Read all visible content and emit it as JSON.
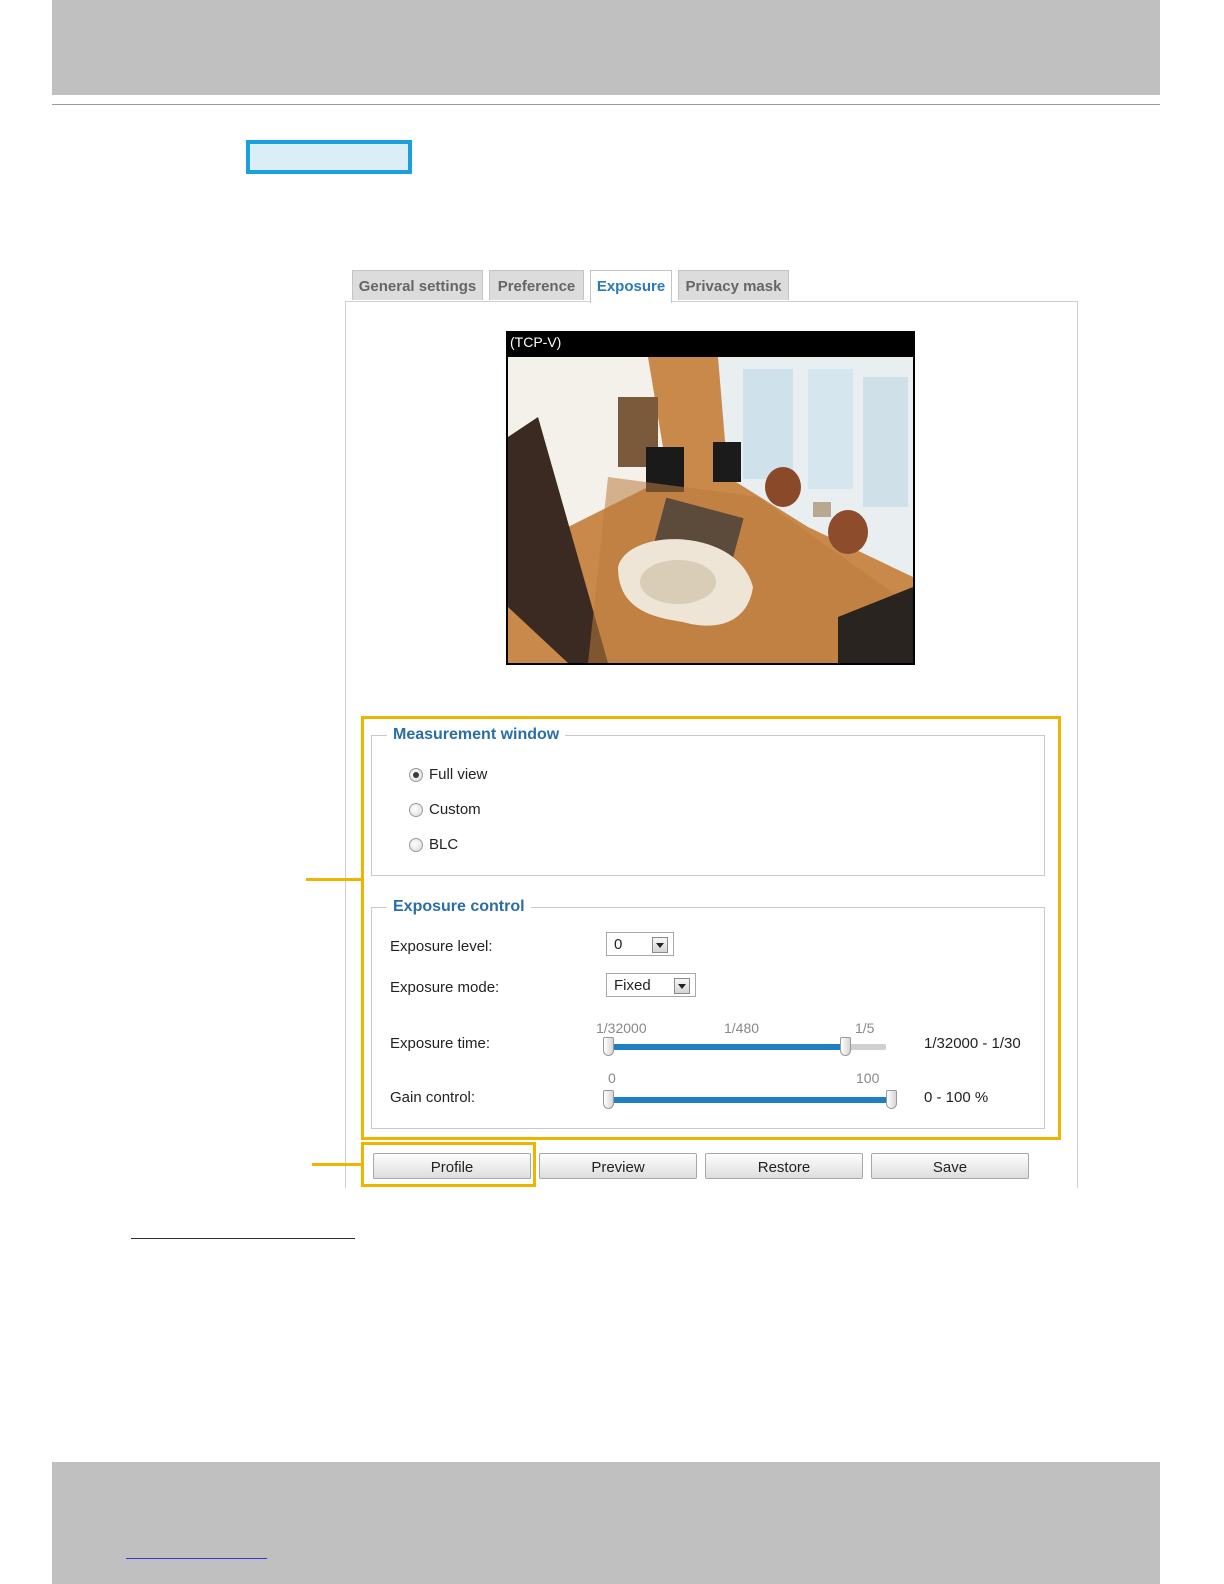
{
  "tabs": [
    "General settings",
    "Preference",
    "Exposure",
    "Privacy mask"
  ],
  "video": {
    "title": "(TCP-V)"
  },
  "measurement_window": {
    "legend": "Measurement window",
    "options": [
      "Full view",
      "Custom",
      "BLC"
    ],
    "selected": "Full view"
  },
  "exposure_control": {
    "legend": "Exposure control",
    "level_label": "Exposure level:",
    "level_value": "0",
    "mode_label": "Exposure mode:",
    "mode_value": "Fixed",
    "time_label": "Exposure time:",
    "time_ticks": [
      "1/32000",
      "1/480",
      "1/5"
    ],
    "time_range": "1/32000 - 1/30",
    "gain_label": "Gain control:",
    "gain_ticks": [
      "0",
      "100"
    ],
    "gain_range": "0 - 100 %"
  },
  "buttons": [
    "Profile",
    "Preview",
    "Restore",
    "Save"
  ],
  "colors": {
    "accent_highlight": "#f0b400",
    "header_box_border": "#1aa0dc",
    "slider_fill": "#1e7fc2",
    "legend_text": "#2a6ea8"
  }
}
